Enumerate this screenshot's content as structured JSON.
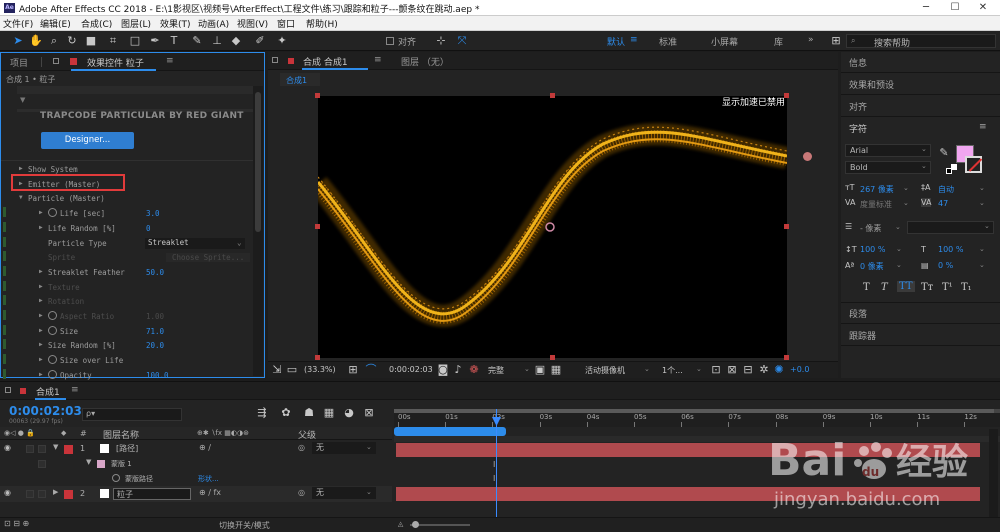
{
  "titlebar": {
    "logo": "Ae",
    "title": "Adobe After Effects CC 2018 - E:\\1影视区\\视频号\\AfterEffect\\工程文件\\练习\\跟踪和粒子---颤条纹在跳动.aep *",
    "min": "─",
    "max": "☐",
    "close": "✕"
  },
  "menu": [
    "文件(F)",
    "编辑(E)",
    "合成(C)",
    "图层(L)",
    "效果(T)",
    "动画(A)",
    "视图(V)",
    "窗口",
    "帮助(H)"
  ],
  "toolbar": {
    "align_label": "对齐",
    "workspaces": [
      "默认",
      "标准",
      "小屏幕",
      "库"
    ],
    "search_placeholder": "搜索帮助",
    "overflow": "»"
  },
  "effects_panel": {
    "tab_project": "项目",
    "tab_effects": "效果控件 粒子",
    "menu_icon": "≡",
    "breadcrumb": "合成 1 • 粒子",
    "plugin_brand": "TRAPCODE PARTICULAR BY RED GIANT",
    "designer_button": "Designer...",
    "rows": [
      {
        "label": "Show System",
        "indent": 1,
        "triangle": "▶"
      },
      {
        "label": "Emitter (Master)",
        "indent": 1,
        "triangle": "▶",
        "highlight": true
      },
      {
        "label": "Particle (Master)",
        "indent": 1,
        "triangle": "▼"
      },
      {
        "label": "Life [sec]",
        "indent": 3,
        "stopwatch": true,
        "value": "3.0",
        "triangle": "▶"
      },
      {
        "label": "Life Random [%]",
        "indent": 3,
        "triangle": "▶",
        "value": "0"
      },
      {
        "label": "Particle Type",
        "indent": 3,
        "value": "Streaklet",
        "dropdown": true
      },
      {
        "label": "Sprite",
        "indent": 3,
        "value": "Choose Sprite...",
        "dim": true
      },
      {
        "label": "Streaklet Feather",
        "indent": 3,
        "triangle": "▶",
        "value": "50.0"
      },
      {
        "label": "Texture",
        "indent": 3,
        "triangle": "▶",
        "dim": true
      },
      {
        "label": "Rotation",
        "indent": 3,
        "triangle": "▶",
        "dim": true
      },
      {
        "label": "Aspect Ratio",
        "indent": 3,
        "triangle": "▶",
        "stopwatch": true,
        "value": "1.00",
        "dim": true
      },
      {
        "label": "Size",
        "indent": 3,
        "triangle": "▶",
        "stopwatch": true,
        "value": "71.0"
      },
      {
        "label": "Size Random [%]",
        "indent": 3,
        "triangle": "▶",
        "value": "20.0"
      },
      {
        "label": "Size over Life",
        "indent": 3,
        "triangle": "▶",
        "stopwatch": true
      },
      {
        "label": "Opacity",
        "indent": 3,
        "triangle": "▶",
        "stopwatch": true,
        "value": "100.0"
      }
    ]
  },
  "comp_panel": {
    "tab_comp": "合成 合成1",
    "tab_layer": "图层 （无）",
    "subtab": "合成1",
    "menu_icon": "≡",
    "overlay_text": "显示加速已禁用",
    "zoom": "(33.3%)",
    "timecode": "0:00:02:03",
    "quality": "完整",
    "camera": "活动摄像机",
    "views": "1个...",
    "exposure": "+0.0"
  },
  "right_panel": {
    "info": "信息",
    "effects_presets": "效果和预设",
    "align": "对齐",
    "character": "字符",
    "menu_icon": "≡",
    "font": "Arial",
    "style": "Bold",
    "size": "267 像素",
    "leading": "自动",
    "kerning": "度量标准",
    "tracking": "47",
    "stroke": "- 像素",
    "vscale": "100 %",
    "hscale": "100 %",
    "baseline": "0 像素",
    "tsume": "0 %",
    "fill_color": "#f1a6f0",
    "text_styles": [
      "T",
      "T",
      "TT",
      "Tт",
      "T¹",
      "T₁"
    ],
    "paragraph": "段落",
    "tracker": "跟踪器"
  },
  "timeline": {
    "tab": "合成1",
    "menu_icon": "≡",
    "timecode": "0:00:02:03",
    "frame_info": "00063 (29.97 fps)",
    "search_placeholder": "ρ▾",
    "col_number": "#",
    "col_layer_name": "图层名称",
    "col_parent": "父级",
    "ruler": [
      "00s",
      "01s",
      "02s",
      "03s",
      "04s",
      "05s",
      "06s",
      "07s",
      "08s",
      "09s",
      "10s",
      "11s",
      "12s"
    ],
    "layers": [
      {
        "num": "1",
        "name": "[路径]",
        "parent": "无",
        "color": "#c9343a"
      },
      {
        "num": "",
        "name": "蒙版 1",
        "parent": "",
        "color": "#d8a6c8"
      },
      {
        "num": "",
        "name": "蒙版路径",
        "parent": "",
        "extra": "形状..."
      },
      {
        "num": "2",
        "name": "粒子",
        "parent": "无",
        "color": "#c9343a"
      }
    ],
    "toggle_label": "切换开关/模式"
  },
  "watermark": {
    "brand": "Bai",
    "paw": "du",
    "cn": "经验",
    "url": "jingyan.baidu.com"
  }
}
